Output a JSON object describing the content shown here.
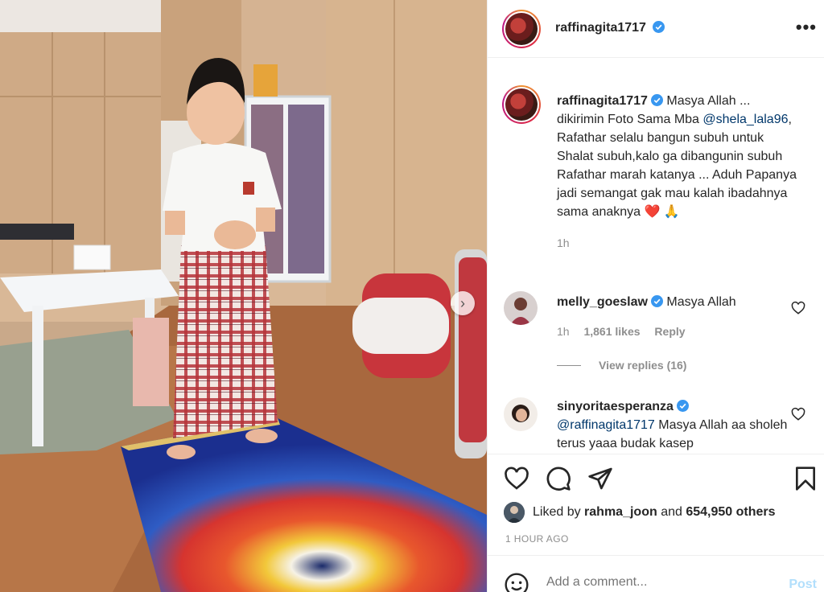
{
  "post": {
    "author": "raffinagita1717",
    "more_icon": "more-dots-icon"
  },
  "caption": {
    "author": "raffinagita1717",
    "text_before": "Masya Allah ... dikirimin Foto Sama Mba",
    "mention": "@shela_lala96",
    "text_after": ", Rafathar selalu bangun subuh untuk Shalat subuh,kalo ga dibangunin subuh Rafathar marah katanya ... Aduh Papanya jadi semangat gak mau kalah ibadahnya sama anaknya ❤️ 🙏",
    "time": "1h"
  },
  "comments": [
    {
      "author": "melly_goeslaw",
      "text": "Masya Allah",
      "time": "1h",
      "likes": "1,861 likes",
      "reply_label": "Reply",
      "view_replies": "View replies (16)"
    },
    {
      "author": "sinyoritaesperanza",
      "mention": "@raffinagita1717",
      "text": "Masya Allah aa sholeh terus yaaa budak kasep"
    }
  ],
  "likes": {
    "prefix": "Liked by",
    "user": "rahma_joon",
    "middle": "and",
    "others": "654,950 others"
  },
  "posted_ago": "1 HOUR AGO",
  "add_comment": {
    "placeholder": "Add a comment...",
    "post_label": "Post"
  },
  "colors": {
    "verified": "#3897f0",
    "link": "#00376b",
    "muted": "#8e8e8e",
    "post_disabled": "#b2dffc",
    "heart": "#ed4956"
  }
}
